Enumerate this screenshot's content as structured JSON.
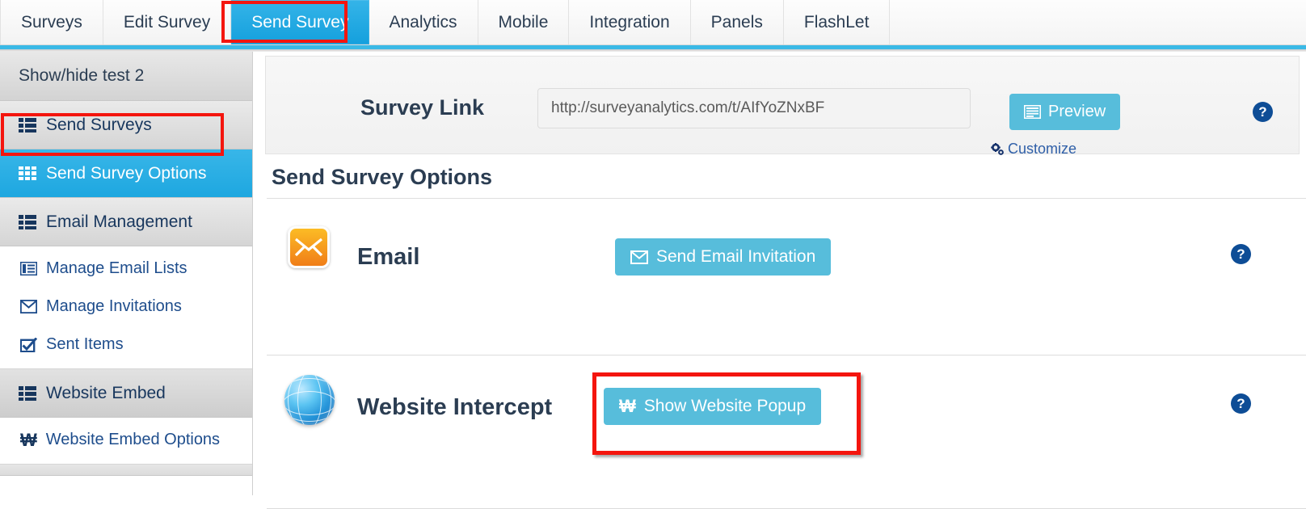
{
  "topnav": {
    "tabs": [
      {
        "label": "Surveys",
        "active": false
      },
      {
        "label": "Edit Survey",
        "active": false
      },
      {
        "label": "Send Survey",
        "active": true
      },
      {
        "label": "Analytics",
        "active": false
      },
      {
        "label": "Mobile",
        "active": false
      },
      {
        "label": "Integration",
        "active": false
      },
      {
        "label": "Panels",
        "active": false
      },
      {
        "label": "FlashLet",
        "active": false
      }
    ],
    "highlight_color": "#f4150e",
    "active_tab_color": "#1ea7e0"
  },
  "sidebar": {
    "title": "Show/hide test 2",
    "items": [
      {
        "label": "Send Surveys",
        "icon": "rows-icon",
        "state": "normal"
      },
      {
        "label": "Send Survey Options",
        "icon": "grid-icon",
        "state": "active"
      },
      {
        "label": "Email Management",
        "icon": "rows-icon",
        "state": "normal"
      }
    ],
    "subitems": [
      {
        "label": "Manage Email Lists",
        "icon": "list-box-icon"
      },
      {
        "label": "Manage Invitations",
        "icon": "envelope-icon"
      },
      {
        "label": "Sent Items",
        "icon": "check-box-icon"
      }
    ],
    "items2": [
      {
        "label": "Website Embed",
        "icon": "rows-icon",
        "state": "grey"
      }
    ],
    "subitems2": [
      {
        "label": "Website Embed Options",
        "icon": "won-icon"
      }
    ]
  },
  "link_panel": {
    "label": "Survey Link",
    "url": "http://surveyanalytics.com/t/AIfYoZNxBF",
    "url_placeholder": "http://surveyanalytics.com/t/",
    "preview_label": "Preview",
    "preview_icon": "window-list-icon",
    "customize_label": "Customize",
    "customize_icon": "gears-icon",
    "help_icon": "question-mark-icon",
    "help_label": "?"
  },
  "main": {
    "section_title": "Send Survey Options",
    "options": [
      {
        "name": "Email",
        "icon": "email-envelope-icon",
        "button_label": "Send Email Invitation",
        "button_icon": "envelope-icon",
        "help_label": "?",
        "highlighted": false
      },
      {
        "name": "Website Intercept",
        "icon": "globe-icon",
        "button_label": "Show Website Popup",
        "button_icon": "won-icon",
        "help_label": "?",
        "highlighted": true
      }
    ]
  },
  "colors": {
    "accent_blue": "#57bddb",
    "active_blue": "#1ea7e0",
    "highlight_red": "#f4150e",
    "heading_navy": "#2b3d52",
    "link_blue": "#1e4d8c"
  }
}
